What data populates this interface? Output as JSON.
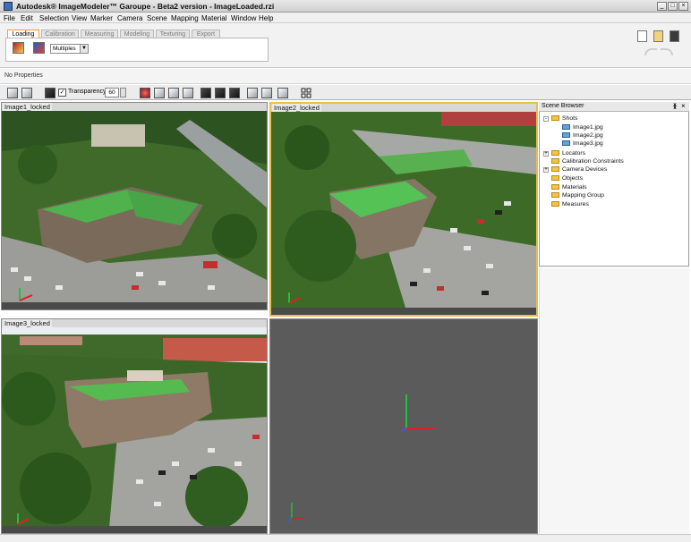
{
  "window": {
    "title": "Autodesk® ImageModeler™ Garoupe - Beta2 version - ImageLoaded.rzi",
    "controls": [
      "_",
      "□",
      "×"
    ]
  },
  "menu": [
    "File",
    "Edit",
    "Selection",
    "View",
    "Marker",
    "Camera",
    "Scene",
    "Mapping",
    "Material",
    "Window",
    "Help"
  ],
  "tabs": [
    "Loading",
    "Calibration",
    "Measuring",
    "Modeling",
    "Texturing",
    "Export"
  ],
  "active_tab": "Loading",
  "loading_panel": {
    "select_value": "Multiples"
  },
  "properties": {
    "label": "No Properties"
  },
  "toolbar2": {
    "transparency_label": "Transparency",
    "transparency_value": "60",
    "checkbox_mark": "✓"
  },
  "viewports": [
    {
      "label": "Image1_locked"
    },
    {
      "label": "Image2_locked"
    },
    {
      "label": "Image3_locked"
    }
  ],
  "scene_browser": {
    "title": "Scene Browser",
    "pin": "ᚕ",
    "close": "×",
    "items": [
      {
        "label": "Shots"
      },
      {
        "label": "Image1.jpg"
      },
      {
        "label": "Image2.jpg"
      },
      {
        "label": "Image3.jpg"
      },
      {
        "label": "Locators"
      },
      {
        "label": "Calibration Constraints"
      },
      {
        "label": "Camera Devices"
      },
      {
        "label": "Objects"
      },
      {
        "label": "Materials"
      },
      {
        "label": "Mapping Group"
      },
      {
        "label": "Measures"
      }
    ]
  },
  "colors": {
    "accent_tab": "#ff9b2f",
    "active_view_border": "#e7c04a",
    "empty_view": "#5b5b5b",
    "axis_x": "#e02020",
    "axis_y": "#20c040"
  }
}
